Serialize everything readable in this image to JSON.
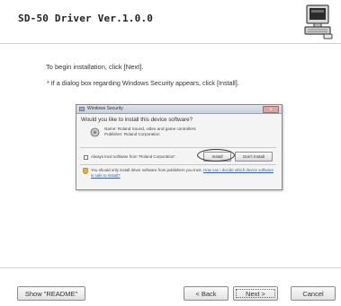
{
  "header": {
    "title": "SD-50 Driver Ver.1.0.0",
    "icon": "computer-icon"
  },
  "instructions": {
    "main": "To begin installation, click [Next].",
    "note": "* If a dialog box regarding Windows Security appears, click [Install]."
  },
  "security_dialog": {
    "title": "Windows Security",
    "question": "Would you like to install this device software?",
    "name_line": "Name: Roland Sound, video and game controllers",
    "publisher_line": "Publisher: Roland Corporation",
    "always_trust": "Always trust software from \"Roland Corporation\".",
    "install_label": "Install",
    "dont_install_label": "Don't Install",
    "warning_text": "You should only install driver software from publishers you trust.",
    "warning_link": "How can I decide which device software is safe to install?"
  },
  "footer": {
    "readme_label": "Show \"README\"",
    "back_label": "< Back",
    "next_label": "Next >",
    "cancel_label": "Cancel"
  },
  "colors": {
    "link": "#3a5fa8",
    "background": "#ffffff"
  }
}
